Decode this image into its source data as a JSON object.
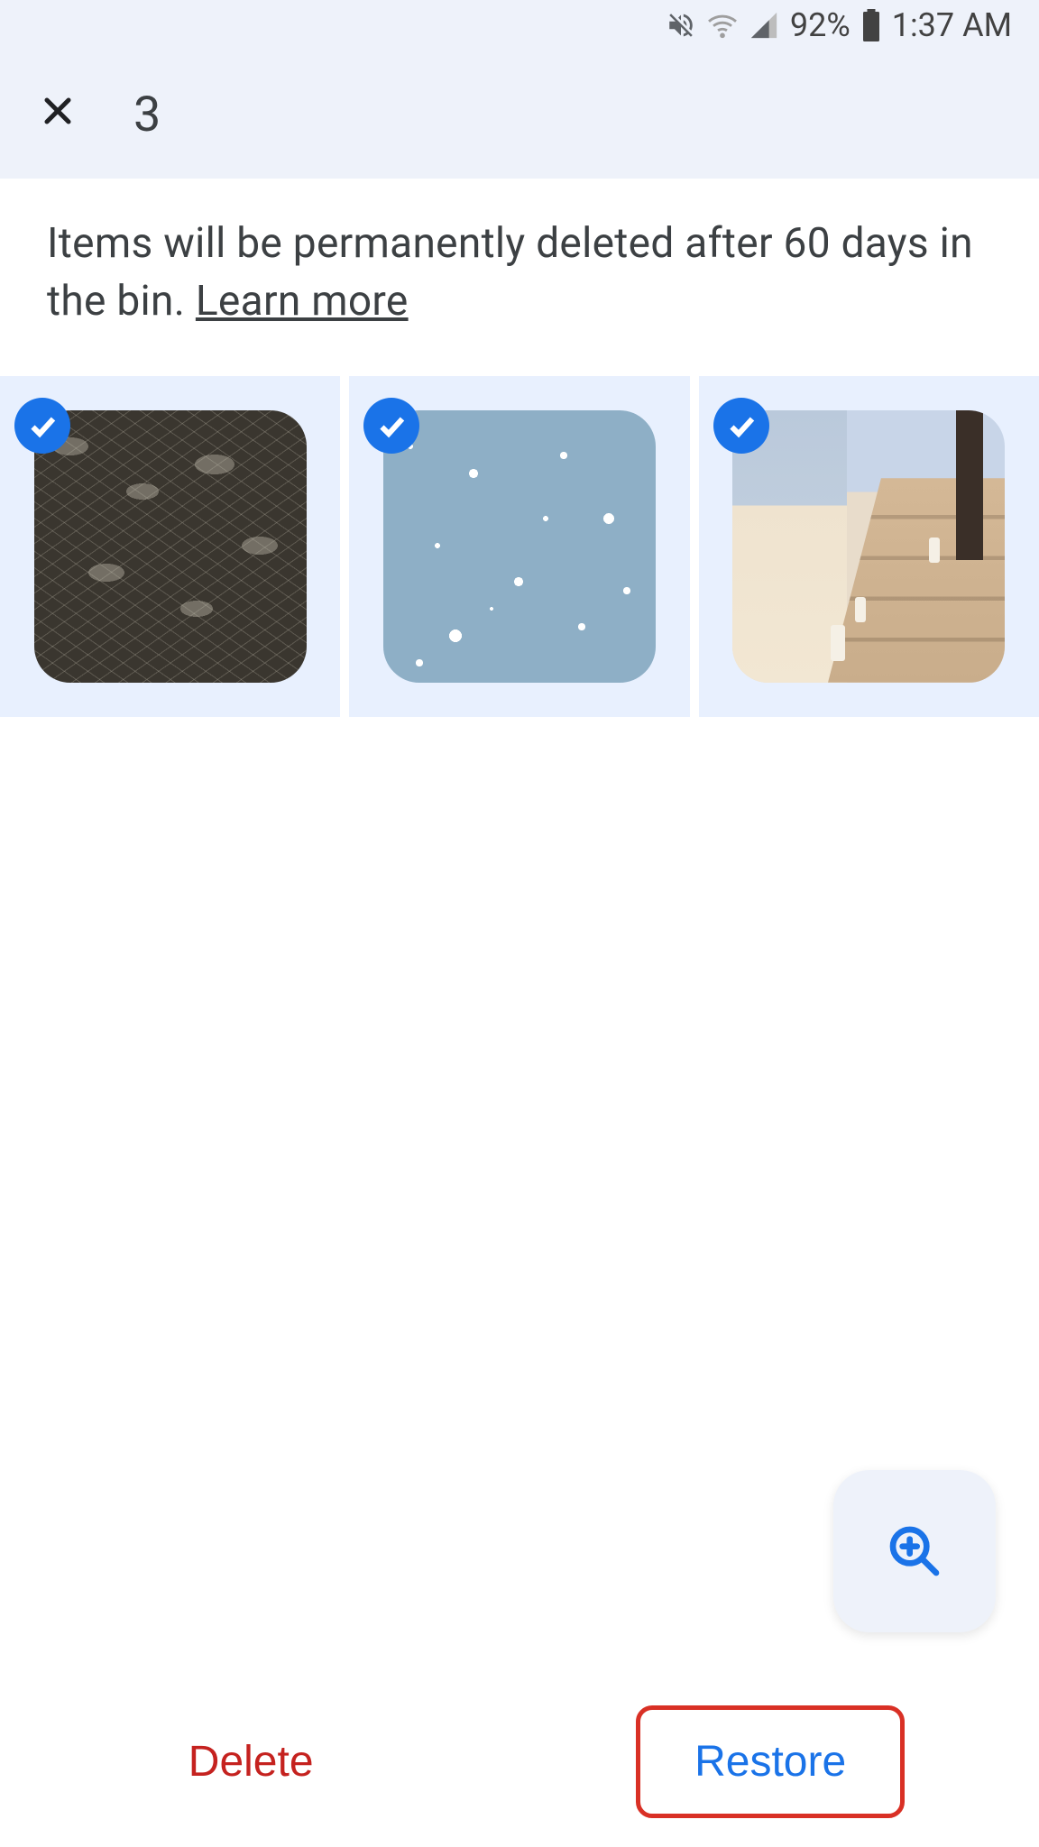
{
  "status_bar": {
    "battery_percent": "92%",
    "time": "1:37 AM"
  },
  "top_bar": {
    "selection_count": "3"
  },
  "info": {
    "message": "Items will be permanently deleted after 60 days in the bin. ",
    "learn_more": "Learn more"
  },
  "photos": [
    {
      "selected": true,
      "desc": "dark-leaves-pattern"
    },
    {
      "selected": true,
      "desc": "blue-stars-pattern"
    },
    {
      "selected": true,
      "desc": "staircase-candles"
    }
  ],
  "actions": {
    "delete": "Delete",
    "restore": "Restore"
  }
}
